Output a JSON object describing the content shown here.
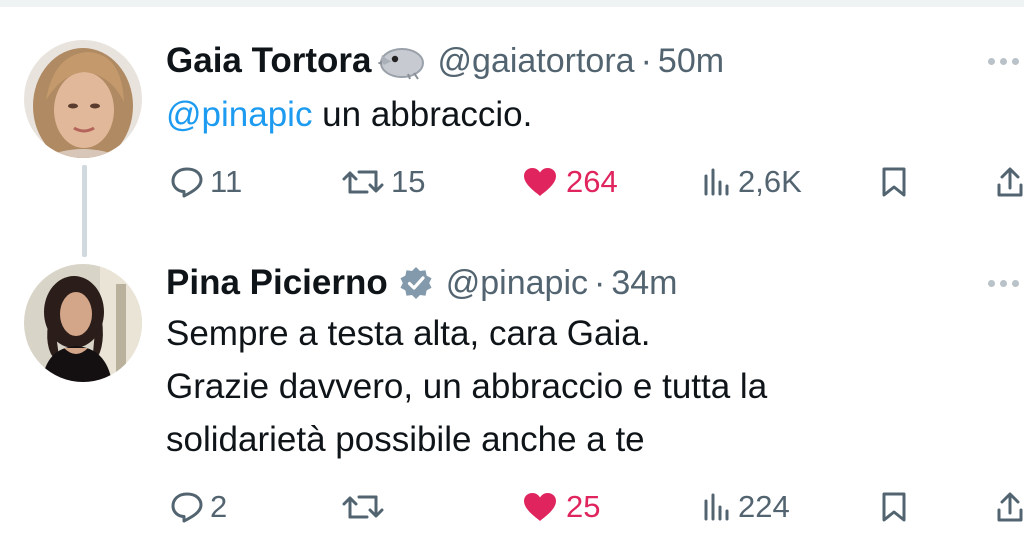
{
  "tweets": [
    {
      "display_name": "Gaia Tortora",
      "name_icon": "bird-emoji-icon",
      "handle": "@gaiatortora",
      "separator": "·",
      "time": "50m",
      "text_mention": "@pinapic",
      "text_rest": " un abbraccio.",
      "replies": "11",
      "retweets": "15",
      "likes": "264",
      "views": "2,6K",
      "liked": true
    },
    {
      "display_name": "Pina Picierno",
      "name_icon": "verified-badge-icon",
      "handle": "@pinapic",
      "separator": "·",
      "time": "34m",
      "text_lines": [
        "Sempre a testa alta, cara Gaia.",
        "Grazie davvero, un abbraccio e tutta la",
        "solidarietà possibile anche a te"
      ],
      "replies": "2",
      "retweets": "",
      "likes": "25",
      "views": "224",
      "liked": true
    }
  ],
  "colors": {
    "text": "#0f1419",
    "secondary": "#536471",
    "mention": "#1d9bf0",
    "like": "#e0245e",
    "thread_line": "#cfd9de"
  }
}
